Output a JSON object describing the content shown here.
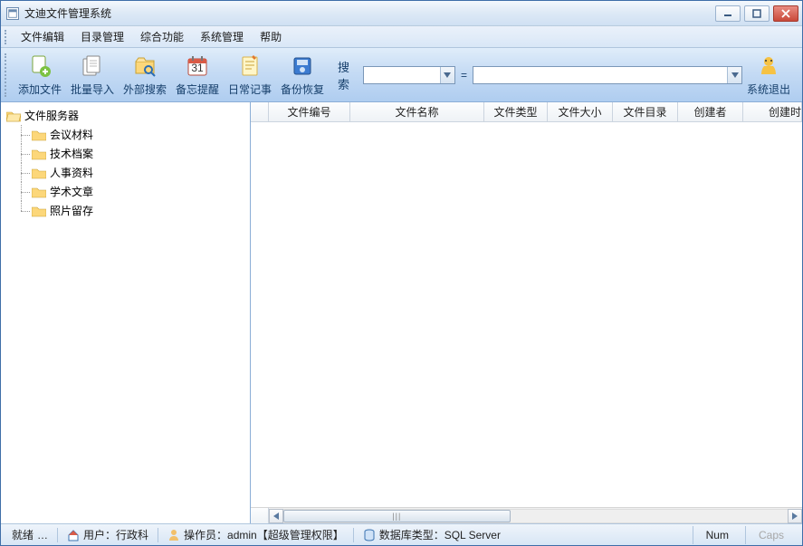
{
  "title": "文迪文件管理系统",
  "menu": {
    "file_edit": "文件编辑",
    "dir_manage": "目录管理",
    "composite": "综合功能",
    "sys_manage": "系统管理",
    "help": "帮助"
  },
  "toolbar": {
    "add_file": "添加文件",
    "batch_import": "批量导入",
    "external_search": "外部搜索",
    "reminder": "备忘提醒",
    "daily_notes": "日常记事",
    "backup_restore": "备份恢复",
    "search_label": "搜索",
    "equals": "=",
    "exit": "系统退出"
  },
  "tree": {
    "root": "文件服务器",
    "items": [
      {
        "label": "会议材料"
      },
      {
        "label": "技术档案"
      },
      {
        "label": "人事资料"
      },
      {
        "label": "学术文章"
      },
      {
        "label": "照片留存"
      }
    ]
  },
  "columns": {
    "file_no": "文件编号",
    "file_name": "文件名称",
    "file_type": "文件类型",
    "file_size": "文件大小",
    "file_dir": "文件目录",
    "creator": "创建者",
    "create_time": "创建时"
  },
  "status": {
    "ready": "就绪",
    "dots": "…",
    "user": "用户：行政科",
    "operator": "操作员：admin【超级管理权限】",
    "db": "数据库类型：SQL Server",
    "num": "Num",
    "caps": "Caps"
  }
}
